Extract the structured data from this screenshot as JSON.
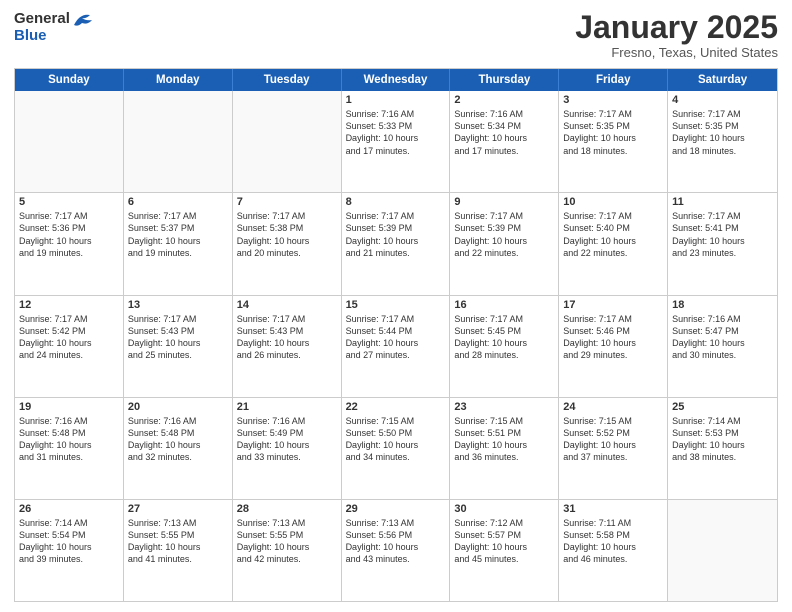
{
  "logo": {
    "line1": "General",
    "line2": "Blue"
  },
  "title": "January 2025",
  "subtitle": "Fresno, Texas, United States",
  "weekdays": [
    "Sunday",
    "Monday",
    "Tuesday",
    "Wednesday",
    "Thursday",
    "Friday",
    "Saturday"
  ],
  "rows": [
    {
      "cells": [
        {
          "empty": true
        },
        {
          "empty": true
        },
        {
          "empty": true
        },
        {
          "day": "1",
          "info": "Sunrise: 7:16 AM\nSunset: 5:33 PM\nDaylight: 10 hours\nand 17 minutes."
        },
        {
          "day": "2",
          "info": "Sunrise: 7:16 AM\nSunset: 5:34 PM\nDaylight: 10 hours\nand 17 minutes."
        },
        {
          "day": "3",
          "info": "Sunrise: 7:17 AM\nSunset: 5:35 PM\nDaylight: 10 hours\nand 18 minutes."
        },
        {
          "day": "4",
          "info": "Sunrise: 7:17 AM\nSunset: 5:35 PM\nDaylight: 10 hours\nand 18 minutes."
        }
      ]
    },
    {
      "cells": [
        {
          "day": "5",
          "info": "Sunrise: 7:17 AM\nSunset: 5:36 PM\nDaylight: 10 hours\nand 19 minutes."
        },
        {
          "day": "6",
          "info": "Sunrise: 7:17 AM\nSunset: 5:37 PM\nDaylight: 10 hours\nand 19 minutes."
        },
        {
          "day": "7",
          "info": "Sunrise: 7:17 AM\nSunset: 5:38 PM\nDaylight: 10 hours\nand 20 minutes."
        },
        {
          "day": "8",
          "info": "Sunrise: 7:17 AM\nSunset: 5:39 PM\nDaylight: 10 hours\nand 21 minutes."
        },
        {
          "day": "9",
          "info": "Sunrise: 7:17 AM\nSunset: 5:39 PM\nDaylight: 10 hours\nand 22 minutes."
        },
        {
          "day": "10",
          "info": "Sunrise: 7:17 AM\nSunset: 5:40 PM\nDaylight: 10 hours\nand 22 minutes."
        },
        {
          "day": "11",
          "info": "Sunrise: 7:17 AM\nSunset: 5:41 PM\nDaylight: 10 hours\nand 23 minutes."
        }
      ]
    },
    {
      "cells": [
        {
          "day": "12",
          "info": "Sunrise: 7:17 AM\nSunset: 5:42 PM\nDaylight: 10 hours\nand 24 minutes."
        },
        {
          "day": "13",
          "info": "Sunrise: 7:17 AM\nSunset: 5:43 PM\nDaylight: 10 hours\nand 25 minutes."
        },
        {
          "day": "14",
          "info": "Sunrise: 7:17 AM\nSunset: 5:43 PM\nDaylight: 10 hours\nand 26 minutes."
        },
        {
          "day": "15",
          "info": "Sunrise: 7:17 AM\nSunset: 5:44 PM\nDaylight: 10 hours\nand 27 minutes."
        },
        {
          "day": "16",
          "info": "Sunrise: 7:17 AM\nSunset: 5:45 PM\nDaylight: 10 hours\nand 28 minutes."
        },
        {
          "day": "17",
          "info": "Sunrise: 7:17 AM\nSunset: 5:46 PM\nDaylight: 10 hours\nand 29 minutes."
        },
        {
          "day": "18",
          "info": "Sunrise: 7:16 AM\nSunset: 5:47 PM\nDaylight: 10 hours\nand 30 minutes."
        }
      ]
    },
    {
      "cells": [
        {
          "day": "19",
          "info": "Sunrise: 7:16 AM\nSunset: 5:48 PM\nDaylight: 10 hours\nand 31 minutes."
        },
        {
          "day": "20",
          "info": "Sunrise: 7:16 AM\nSunset: 5:48 PM\nDaylight: 10 hours\nand 32 minutes."
        },
        {
          "day": "21",
          "info": "Sunrise: 7:16 AM\nSunset: 5:49 PM\nDaylight: 10 hours\nand 33 minutes."
        },
        {
          "day": "22",
          "info": "Sunrise: 7:15 AM\nSunset: 5:50 PM\nDaylight: 10 hours\nand 34 minutes."
        },
        {
          "day": "23",
          "info": "Sunrise: 7:15 AM\nSunset: 5:51 PM\nDaylight: 10 hours\nand 36 minutes."
        },
        {
          "day": "24",
          "info": "Sunrise: 7:15 AM\nSunset: 5:52 PM\nDaylight: 10 hours\nand 37 minutes."
        },
        {
          "day": "25",
          "info": "Sunrise: 7:14 AM\nSunset: 5:53 PM\nDaylight: 10 hours\nand 38 minutes."
        }
      ]
    },
    {
      "cells": [
        {
          "day": "26",
          "info": "Sunrise: 7:14 AM\nSunset: 5:54 PM\nDaylight: 10 hours\nand 39 minutes."
        },
        {
          "day": "27",
          "info": "Sunrise: 7:13 AM\nSunset: 5:55 PM\nDaylight: 10 hours\nand 41 minutes."
        },
        {
          "day": "28",
          "info": "Sunrise: 7:13 AM\nSunset: 5:55 PM\nDaylight: 10 hours\nand 42 minutes."
        },
        {
          "day": "29",
          "info": "Sunrise: 7:13 AM\nSunset: 5:56 PM\nDaylight: 10 hours\nand 43 minutes."
        },
        {
          "day": "30",
          "info": "Sunrise: 7:12 AM\nSunset: 5:57 PM\nDaylight: 10 hours\nand 45 minutes."
        },
        {
          "day": "31",
          "info": "Sunrise: 7:11 AM\nSunset: 5:58 PM\nDaylight: 10 hours\nand 46 minutes."
        },
        {
          "empty": true
        }
      ]
    }
  ]
}
